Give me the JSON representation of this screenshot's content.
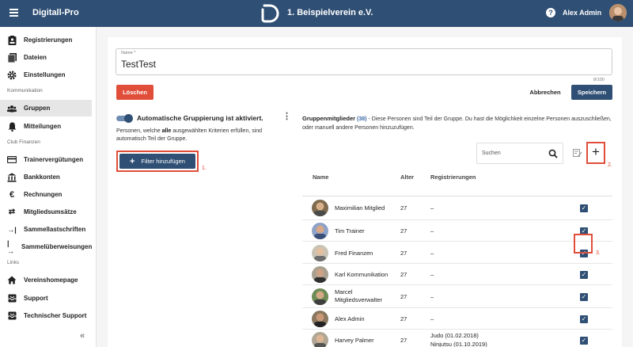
{
  "topbar": {
    "app_name": "Digitall-Pro",
    "club_name": "1. Beispielverein e.V.",
    "help": "?",
    "user_name": "Alex Admin",
    "brand_color": "#2f4f74"
  },
  "sidebar": {
    "items": [
      {
        "label": "Registrierungen",
        "icon": "clipboard-icon"
      },
      {
        "label": "Dateien",
        "icon": "files-icon"
      },
      {
        "label": "Einstellungen",
        "icon": "gear-icon"
      },
      {
        "label": "Gruppen",
        "icon": "group-icon",
        "active": true
      },
      {
        "label": "Mitteilungen",
        "icon": "bell-icon"
      },
      {
        "label": "Trainervergütungen",
        "icon": "card-icon"
      },
      {
        "label": "Bankkonten",
        "icon": "bank-icon"
      },
      {
        "label": "Rechnungen",
        "icon": "euro-icon"
      },
      {
        "label": "Mitgliedsumsätze",
        "icon": "swap-icon"
      },
      {
        "label": "Sammellastschriften",
        "icon": "arrow-in-icon"
      },
      {
        "label": "Sammelüberweisungen",
        "icon": "arrow-out-icon"
      },
      {
        "label": "Vereinshomepage",
        "icon": "home-icon"
      },
      {
        "label": "Support",
        "icon": "inbox-icon"
      },
      {
        "label": "Technischer Support",
        "icon": "inbox-icon"
      }
    ],
    "sections": [
      "Kommunikation",
      "Club Finanzen",
      "Links"
    ],
    "collapse": "«"
  },
  "form": {
    "name_label": "Name *",
    "name_value": "TestTest",
    "counter": "8/100",
    "delete_label": "Löschen",
    "cancel_label": "Abbrechen",
    "save_label": "Speichern",
    "delete_color": "#e04e3a"
  },
  "auto": {
    "title": "Automatische Gruppierung ist aktiviert.",
    "desc_pre": "Personen, welche ",
    "desc_bold": "alle",
    "desc_post": " ausgewählten Kriterien erfüllen, sind automatisch Teil der Gruppe.",
    "filter_label": "Filter hinzufügen",
    "toggle_on": true
  },
  "annotations": {
    "a1": "1.",
    "a2": "2.",
    "a3": "3.",
    "color": "#e04e3a"
  },
  "members": {
    "title": "Gruppenmitglieder",
    "count": "(38)",
    "desc": " - Diese Personen sind Teil der Gruppe. Du hast die Möglichkeit einzelne Personen auszuschließen, oder manuell andere Personen hinzuzufügen.",
    "search_placeholder": "Suchen",
    "add": "+",
    "columns": {
      "name": "Name",
      "age": "Alter",
      "reg": "Registrierungen"
    },
    "rows": [
      {
        "name": "Maximilian Mitglied",
        "age": "27",
        "reg": "–",
        "checked": true
      },
      {
        "name": "Tim Trainer",
        "age": "27",
        "reg": "–",
        "checked": true
      },
      {
        "name": "Fred Finanzen",
        "age": "27",
        "reg": "–",
        "checked": true
      },
      {
        "name": "Karl Kommunikation",
        "age": "27",
        "reg": "–",
        "checked": true
      },
      {
        "name": "Marcel Mitgliedsverwalter",
        "age": "27",
        "reg": "–",
        "checked": true
      },
      {
        "name": "Alex Admin",
        "age": "27",
        "reg": "–",
        "checked": true
      },
      {
        "name": "Harvey Palmer",
        "age": "27",
        "reg": "Judo (01.02.2018)\nNinjutsu (01.10.2019)",
        "checked": true
      }
    ]
  }
}
